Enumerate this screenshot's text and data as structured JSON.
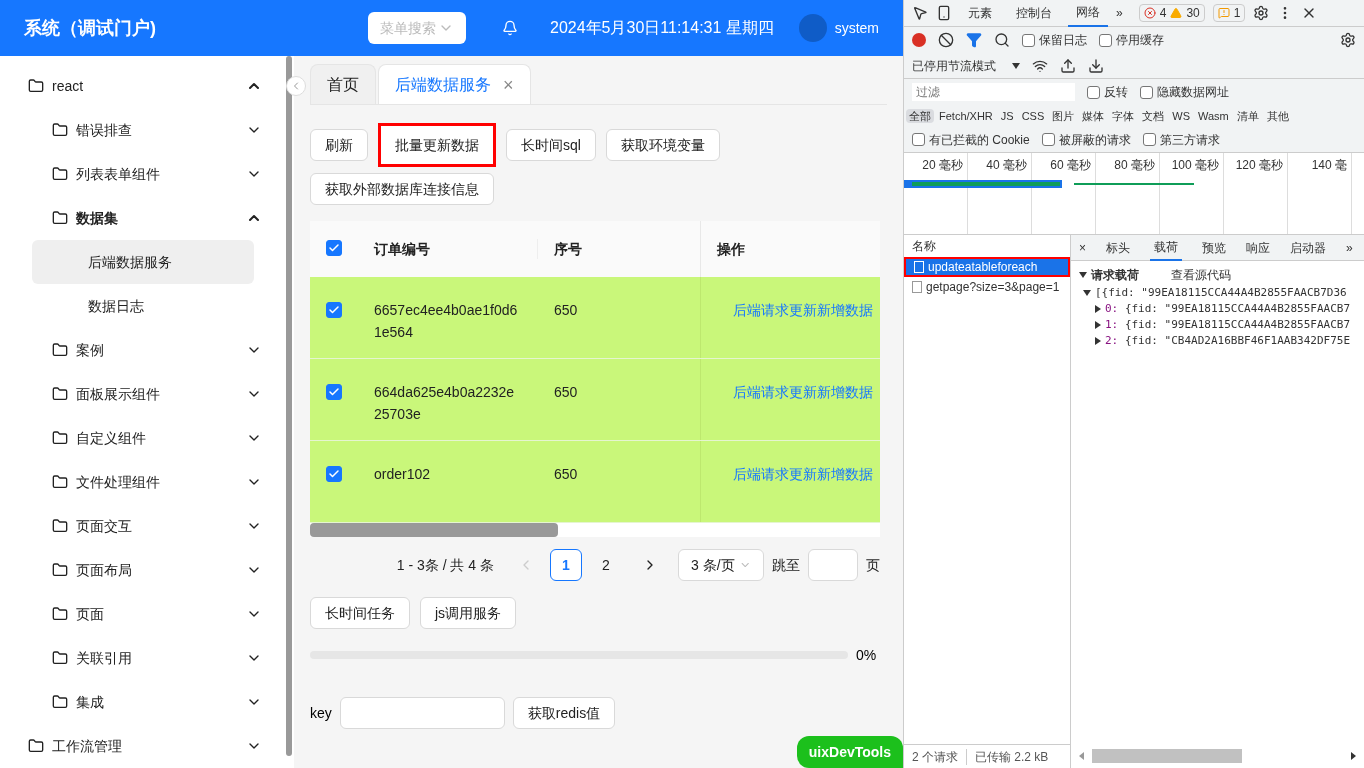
{
  "header": {
    "title": "系统（调试门户)",
    "search": {
      "placeholder": "菜单搜索"
    },
    "datetime": "2024年5月30日11:14:31 星期四",
    "user": "system"
  },
  "sidebar": {
    "items": [
      {
        "label": "react",
        "expanded": true,
        "children": [
          {
            "label": "错误排查",
            "expanded": false
          },
          {
            "label": "列表表单组件",
            "expanded": false
          },
          {
            "label": "数据集",
            "expanded": true,
            "children": [
              {
                "label": "后端数据服务",
                "selected": true
              },
              {
                "label": "数据日志",
                "selected": false
              }
            ]
          },
          {
            "label": "案例",
            "expanded": false
          },
          {
            "label": "面板展示组件",
            "expanded": false
          },
          {
            "label": "自定义组件",
            "expanded": false
          },
          {
            "label": "文件处理组件",
            "expanded": false
          },
          {
            "label": "页面交互",
            "expanded": false
          },
          {
            "label": "页面布局",
            "expanded": false
          },
          {
            "label": "页面",
            "expanded": false
          },
          {
            "label": "关联引用",
            "expanded": false
          },
          {
            "label": "集成",
            "expanded": false
          }
        ]
      },
      {
        "label": "工作流管理",
        "expanded": false
      }
    ]
  },
  "tabs": [
    {
      "label": "首页",
      "selected": false
    },
    {
      "label": "后端数据服务",
      "selected": true,
      "close": "×"
    }
  ],
  "buttons": [
    {
      "label": "刷新",
      "highlighted": false
    },
    {
      "label": "批量更新数据",
      "highlighted": true
    },
    {
      "label": "长时间sql",
      "highlighted": false
    },
    {
      "label": "获取环境变量",
      "highlighted": false
    },
    {
      "label": "获取外部数据库连接信息",
      "highlighted": false
    }
  ],
  "table": {
    "all_checked": true,
    "columns": [
      "订单编号",
      "序号",
      "操作"
    ],
    "rows": [
      {
        "checked": true,
        "order_no": "6657ec4ee4b0ae1f0d6\n1e564",
        "seq": "650",
        "action": "后端请求更新新增数据"
      },
      {
        "checked": true,
        "order_no": "664da625e4b0a2232e\n25703e",
        "seq": "650",
        "action": "后端请求更新新增数据"
      },
      {
        "checked": true,
        "order_no": "order102",
        "seq": "650",
        "action": "后端请求更新新增数据"
      }
    ]
  },
  "pagination": {
    "summary": "1 - 3条 / 共 4 条",
    "pages": [
      {
        "label": "1",
        "selected": true
      },
      {
        "label": "2",
        "selected": false
      }
    ],
    "page_size": "3 条/页",
    "jump_label": "跳至",
    "page_unit": "页"
  },
  "task_buttons": [
    "长时间任务",
    "js调用服务"
  ],
  "progress": {
    "level": 0,
    "reading": "0%"
  },
  "redis": {
    "label": "key",
    "button": "获取redis值"
  },
  "floating_button": "uixDevTools",
  "devtools": {
    "tabs": [
      {
        "label": "元素",
        "selected": false
      },
      {
        "label": "控制台",
        "selected": false
      },
      {
        "label": "网络",
        "selected": true
      }
    ],
    "more": "»",
    "errors": "4",
    "warnings": "30",
    "issues": "1",
    "toolbar_checks": [
      {
        "label": "保留日志",
        "checked": false
      },
      {
        "label": "停用缓存",
        "checked": false
      }
    ],
    "throttle": "已停用节流模式",
    "filter": {
      "placeholder": "过滤"
    },
    "filter_checks": [
      {
        "label": "反转",
        "checked": false
      },
      {
        "label": "隐藏数据网址",
        "checked": false
      }
    ],
    "types": [
      {
        "label": "全部",
        "selected": true
      },
      {
        "label": "Fetch/XHR",
        "selected": false
      },
      {
        "label": "JS",
        "selected": false
      },
      {
        "label": "CSS",
        "selected": false
      },
      {
        "label": "图片",
        "selected": false
      },
      {
        "label": "媒体",
        "selected": false
      },
      {
        "label": "字体",
        "selected": false
      },
      {
        "label": "文档",
        "selected": false
      },
      {
        "label": "WS",
        "selected": false
      },
      {
        "label": "Wasm",
        "selected": false
      },
      {
        "label": "清单",
        "selected": false
      },
      {
        "label": "其他",
        "selected": false
      }
    ],
    "extra_checks": [
      {
        "label": "有已拦截的 Cookie",
        "checked": false
      },
      {
        "label": "被屏蔽的请求",
        "checked": false
      },
      {
        "label": "第三方请求",
        "checked": false
      }
    ],
    "timeline_ticks": [
      "20 毫秒",
      "40 毫秒",
      "60 毫秒",
      "80 毫秒",
      "100 毫秒",
      "120 毫秒",
      "140 毫"
    ],
    "requests_header": "名称",
    "requests": [
      {
        "name": "updateatableforeach",
        "selected": true,
        "highlighted": true
      },
      {
        "name": "getpage?size=3&page=1",
        "selected": false,
        "highlighted": false
      }
    ],
    "detail_close": "×",
    "detail_tabs": [
      {
        "label": "标头",
        "selected": false
      },
      {
        "label": "载荷",
        "selected": true
      },
      {
        "label": "预览",
        "selected": false
      },
      {
        "label": "响应",
        "selected": false
      },
      {
        "label": "启动器",
        "selected": false
      }
    ],
    "detail_more": "»",
    "payload": {
      "title": "请求载荷",
      "view_source": "查看源代码",
      "root": "[{fid: \"99EA18115CCA44A4B2855FAACB7D36",
      "items": [
        {
          "index": "0:",
          "value": "{fid: \"99EA18115CCA44A4B2855FAACB7"
        },
        {
          "index": "1:",
          "value": "{fid: \"99EA18115CCA44A4B2855FAACB7"
        },
        {
          "index": "2:",
          "value": "{fid: \"CB4AD2A16BBF46F1AAB342DF75E"
        }
      ]
    },
    "status": [
      "2 个请求",
      "已传输 2.2 kB"
    ]
  }
}
